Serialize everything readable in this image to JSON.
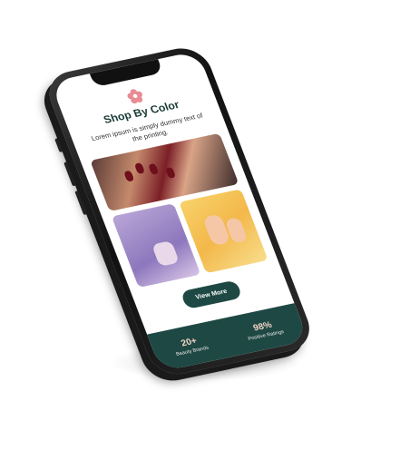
{
  "section": {
    "title": "Shop By Color",
    "description": "Lorem ipsum is simply dummy text of the printing."
  },
  "cta": {
    "label": "View More"
  },
  "stats": [
    {
      "value": "20+",
      "label": "Beauty Brands"
    },
    {
      "value": "98%",
      "label": "Positive Ratings"
    }
  ],
  "colors": {
    "accent": "#1e4843",
    "stat_value": "#f1d3c8",
    "flower": "#e98b94"
  },
  "icons": {
    "logo": "flower-icon"
  }
}
